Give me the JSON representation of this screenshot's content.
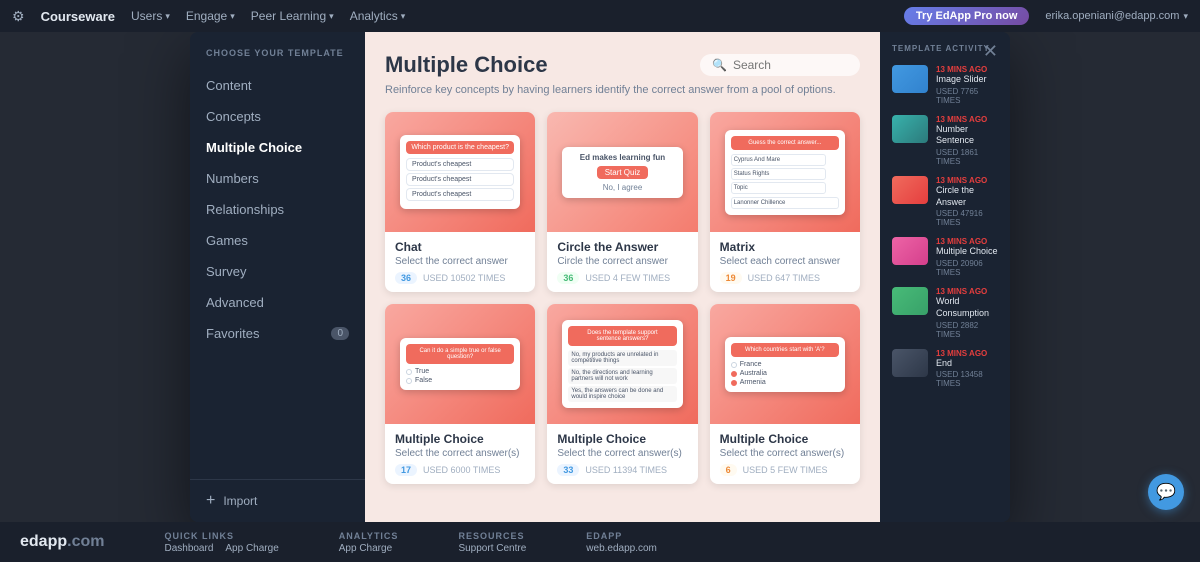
{
  "topnav": {
    "brand": "Courseware",
    "items": [
      "Users",
      "Engage",
      "Peer Learning",
      "Analytics"
    ],
    "try_pro": "Try EdApp Pro now",
    "user_email": "erika.openiani@edapp.com"
  },
  "sidebar": {
    "header": "CHOOSE YOUR TEMPLATE",
    "items": [
      {
        "label": "Content",
        "active": false
      },
      {
        "label": "Concepts",
        "active": false
      },
      {
        "label": "Multiple Choice",
        "active": true
      },
      {
        "label": "Numbers",
        "active": false
      },
      {
        "label": "Relationships",
        "active": false
      },
      {
        "label": "Games",
        "active": false
      },
      {
        "label": "Survey",
        "active": false
      },
      {
        "label": "Advanced",
        "active": false
      },
      {
        "label": "Favorites",
        "active": false,
        "badge": "0"
      }
    ],
    "import_label": "Import"
  },
  "main": {
    "title": "Multiple Choice",
    "subtitle": "Reinforce key concepts by having learners identify the correct answer from a pool of options.",
    "search_placeholder": "Search",
    "cards": [
      {
        "name": "Chat",
        "desc": "Select the correct answer",
        "stat_count": "36",
        "stat_label": "USED 10502 TIMES",
        "badge_color": "blue"
      },
      {
        "name": "Circle the Answer",
        "desc": "Circle the correct answer",
        "stat_count": "36",
        "stat_label": "USED 4 FEW TIMES",
        "badge_color": "green"
      },
      {
        "name": "Matrix",
        "desc": "Select each correct answer",
        "stat_count": "19",
        "stat_label": "USED 647 TIMES",
        "badge_color": "orange"
      },
      {
        "name": "Multiple Choice",
        "desc": "Select the correct answer(s)",
        "stat_count": "17",
        "stat_label": "USED 6000 TIMES",
        "badge_color": "blue"
      },
      {
        "name": "Multiple Choice",
        "desc": "Select the correct answer(s)",
        "stat_count": "33",
        "stat_label": "USED 11394 TIMES",
        "badge_color": "blue"
      },
      {
        "name": "Multiple Choice",
        "desc": "Select the correct answer(s)",
        "stat_count": "6",
        "stat_label": "USED 5 FEW TIMES",
        "badge_color": "orange"
      }
    ]
  },
  "template_activity": {
    "header": "TEMPLATE ACTIVITY",
    "items": [
      {
        "time": "13 MINS AGO",
        "name": "Image Slider",
        "used": "USED 7765 TIMES",
        "color": "blue"
      },
      {
        "time": "13 MINS AGO",
        "name": "Number Sentence",
        "used": "USED 1861 TIMES",
        "color": "teal"
      },
      {
        "time": "13 MINS AGO",
        "name": "Circle the Answer",
        "used": "USED 47916 TIMES",
        "color": "salmon"
      },
      {
        "time": "13 MINS AGO",
        "name": "Multiple Choice",
        "used": "USED 20906 TIMES",
        "color": "pink"
      },
      {
        "time": "13 MINS AGO",
        "name": "World Consumption",
        "used": "USED 2882 TIMES",
        "color": "green"
      },
      {
        "time": "13 MINS AGO",
        "name": "End",
        "used": "USED 13458 TIMES",
        "color": "darkblue"
      }
    ]
  },
  "footer": {
    "brand": "edapp.com",
    "sections": [
      {
        "title": "QUICK LINKS",
        "links": [
          "Dashboard",
          "App Charge"
        ]
      },
      {
        "title": "ANALYTICS",
        "links": [
          "App Charge"
        ]
      },
      {
        "title": "RESOURCES",
        "links": [
          "Support Centre"
        ]
      },
      {
        "title": "EDAPP",
        "links": [
          "web.edapp.com"
        ]
      }
    ]
  },
  "preview_texts": {
    "chat_question": "Which product is the cheapest?",
    "chat_opt1": "Product's cheapest",
    "chat_opt2": "Product's cheapest",
    "chat_opt3": "Product's cheapest",
    "circle_q": "Ed makes learning fun",
    "matrix_q": "Guess the correct answer...",
    "matrix_opt1": "Cyprus And Mare",
    "matrix_opt2": "Status Rights",
    "mc1_q": "Can it do a simple true or false question?",
    "mc1_opt1": "True",
    "mc1_opt2": "False",
    "mc2_q": "Does the template support sentence answers?",
    "mc3_q": "Which countries start with 'A'?",
    "mc3_opt1": "France",
    "mc3_opt2": "Australia",
    "mc3_opt3": "Armenia"
  }
}
